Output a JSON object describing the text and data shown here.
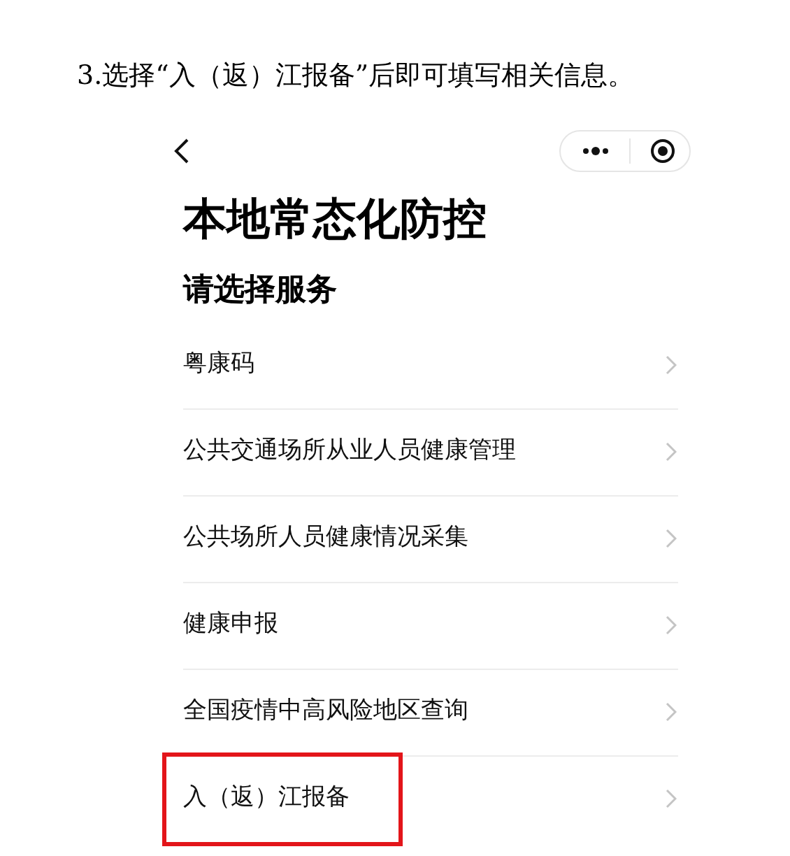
{
  "caption": "3.选择“入（返）江报备”后即可填写相关信息。",
  "title": "本地常态化防控",
  "subtitle": "请选择服务",
  "services": [
    {
      "label": "粤康码",
      "highlighted": false
    },
    {
      "label": "公共交通场所从业人员健康管理",
      "highlighted": false
    },
    {
      "label": "公共场所人员健康情况采集",
      "highlighted": false
    },
    {
      "label": "健康申报",
      "highlighted": false
    },
    {
      "label": "全国疫情中高风险地区查询",
      "highlighted": false
    },
    {
      "label": "入（返）江报备",
      "highlighted": true
    }
  ]
}
